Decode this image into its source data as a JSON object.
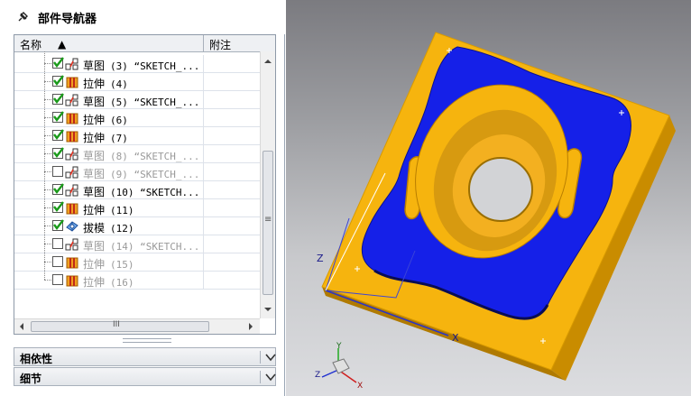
{
  "navigator": {
    "title": "部件导航器",
    "columns": {
      "name": "名称",
      "sort_glyph": "▲",
      "notes": "附注"
    },
    "rows": [
      {
        "checked": true,
        "icon": "sketch-icon",
        "label": "草图",
        "num": "(3) “SKETCH_...",
        "dim": false
      },
      {
        "checked": true,
        "icon": "extrude-icon",
        "label": "拉伸",
        "num": "(4)",
        "dim": false
      },
      {
        "checked": true,
        "icon": "sketch-icon",
        "label": "草图",
        "num": "(5) “SKETCH_...",
        "dim": false
      },
      {
        "checked": true,
        "icon": "extrude-icon",
        "label": "拉伸",
        "num": "(6)",
        "dim": false
      },
      {
        "checked": true,
        "icon": "extrude-icon",
        "label": "拉伸",
        "num": "(7)",
        "dim": false
      },
      {
        "checked": true,
        "icon": "sketch-icon",
        "label": "草图",
        "num": "(8) “SKETCH_...",
        "dim": true
      },
      {
        "checked": false,
        "icon": "sketch-icon",
        "label": "草图",
        "num": "(9) “SKETCH_...",
        "dim": true
      },
      {
        "checked": true,
        "icon": "sketch-icon",
        "label": "草图",
        "num": "(10) “SKETCH...",
        "dim": false
      },
      {
        "checked": true,
        "icon": "extrude-icon",
        "label": "拉伸",
        "num": "(11)",
        "dim": false
      },
      {
        "checked": true,
        "icon": "draft-icon",
        "label": "拔模",
        "num": "(12)",
        "dim": false
      },
      {
        "checked": false,
        "icon": "sketch-icon",
        "label": "草图",
        "num": "(14) “SKETCH...",
        "dim": true
      },
      {
        "checked": false,
        "icon": "extrude-icon",
        "label": "拉伸",
        "num": "(15)",
        "dim": true
      },
      {
        "checked": false,
        "icon": "extrude-icon",
        "label": "拉伸",
        "num": "(16)",
        "dim": true
      }
    ],
    "hscroll_thumb_glyph": "III",
    "vscroll_thumb_glyph": "≡",
    "sections": [
      {
        "label": "相依性"
      },
      {
        "label": "细节"
      }
    ]
  },
  "viewport": {
    "triad": {
      "x": "X",
      "y": "Y",
      "z": "Z"
    },
    "datum_labels": {
      "z": "Z",
      "x": "X"
    },
    "colors": {
      "plate": "#f6b40e",
      "pocket": "#1520e8",
      "background_top": "#7b7b80",
      "background_bottom": "#dcdde0"
    }
  }
}
